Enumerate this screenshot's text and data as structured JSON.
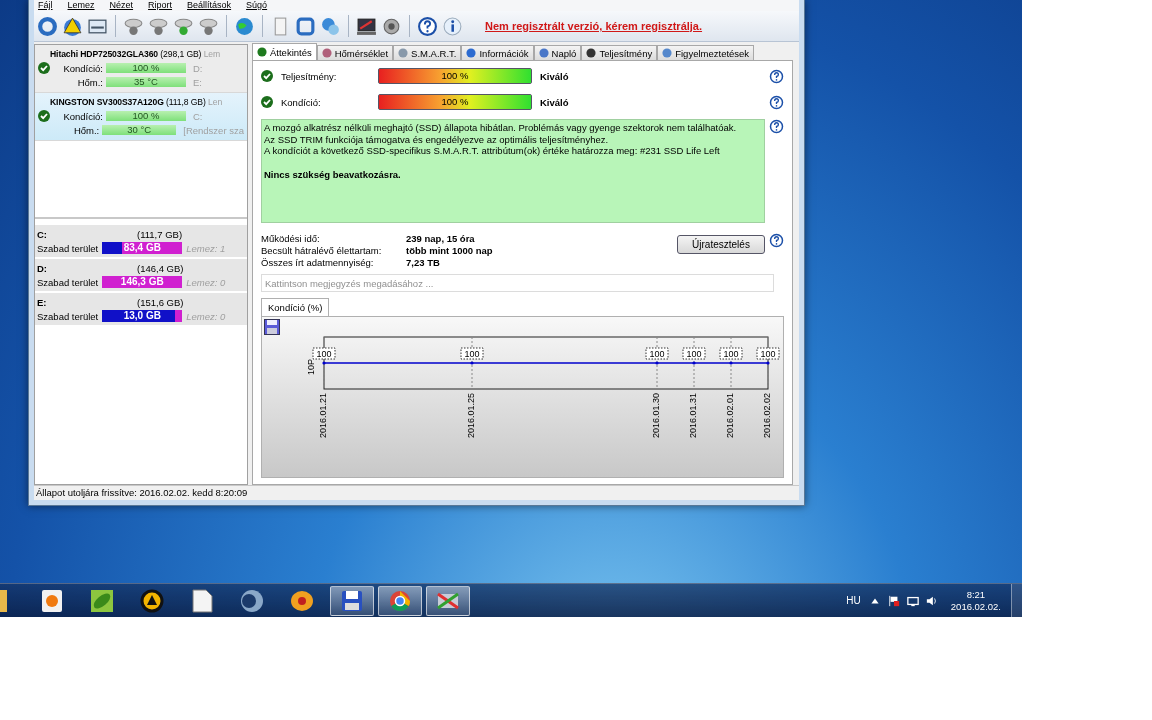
{
  "menu": [
    "Fájl",
    "Lemez",
    "Nézet",
    "Riport",
    "Beállítások",
    "Súgó"
  ],
  "register_link": "Nem regisztrált verzió, kérem regisztrálja.",
  "disks": [
    {
      "name": "Hitachi HDP725032GLA360",
      "size": "(298,1 GB)",
      "extra": "Lem",
      "selected": false,
      "rows": [
        {
          "label": "Kondíció:",
          "value": "100 %",
          "level": 1,
          "note": "D:"
        },
        {
          "label": "Hőm.:",
          "value": "35 °C",
          "level": 1,
          "note": "E:"
        }
      ]
    },
    {
      "name": "KINGSTON SV300S37A120G",
      "size": "(111,8 GB)",
      "extra": "Len",
      "selected": true,
      "rows": [
        {
          "label": "Kondíció:",
          "value": "100 %",
          "level": 1,
          "note": "C:"
        },
        {
          "label": "Hőm.:",
          "value": "30 °C",
          "level": 1,
          "note": "[Rendszer sza"
        }
      ]
    }
  ],
  "partitions": [
    {
      "letter": "C:",
      "size": "(111,7 GB)",
      "label": "Szabad terület",
      "free": "83,4 GB",
      "level": 0.75,
      "disk": "Lemez: 1"
    },
    {
      "letter": "D:",
      "size": "(146,4 GB)",
      "label": "Szabad terület",
      "free": "146,3 GB",
      "level": 1,
      "disk": "Lemez: 0"
    },
    {
      "letter": "E:",
      "size": "(151,6 GB)",
      "label": "Szabad terület",
      "free": "13,0 GB",
      "level": 0.09,
      "disk": "Lemez: 0"
    }
  ],
  "tabs": [
    {
      "label": "Áttekintés",
      "selected": true
    },
    {
      "label": "Hőmérséklet",
      "selected": false
    },
    {
      "label": "S.M.A.R.T.",
      "selected": false
    },
    {
      "label": "Információk",
      "selected": false
    },
    {
      "label": "Napló",
      "selected": false
    },
    {
      "label": "Teljesítmény",
      "selected": false
    },
    {
      "label": "Figyelmeztetések",
      "selected": false
    }
  ],
  "metrics": [
    {
      "label": "Teljesítmény:",
      "level": 1,
      "reading": "100 %",
      "rating": "Kiváló"
    },
    {
      "label": "Kondíció:",
      "level": 1,
      "reading": "100 %",
      "rating": "Kiváló"
    }
  ],
  "message": {
    "lines": [
      "A mozgó alkatrész nélküli meghajtó (SSD) állapota hibátlan. Problémás vagy gyenge szektorok nem találhatóak.",
      "Az SSD TRIM funkciója támogatva és engedélyezve az optimális teljesítményhez.",
      "A kondíciót a következő SSD-specifikus S.M.A.R.T. attribútum(ok) értéke határozza meg:  #231 SSD Life Left"
    ],
    "conclusion": "Nincs szükség beavatkozásra."
  },
  "stats": [
    {
      "label": "Működési idő:",
      "value": "239 nap, 15 óra"
    },
    {
      "label": "Becsült hátralévő élettartam:",
      "value": "több mint 1000 nap"
    },
    {
      "label": "Összes írt adatmennyiség:",
      "value": "7,23 TB"
    }
  ],
  "retest_button": "Újratesztelés",
  "note": {
    "placeholder": "Kattintson megjegyzés megadásához ..."
  },
  "chart_tab": "Kondíció  (%)",
  "chart": {
    "axis_text": "10P",
    "points": [
      {
        "date": "2016.01.21",
        "label": "100"
      },
      {
        "date": "2016.01.25",
        "label": "100"
      },
      {
        "date": "2016.01.30",
        "label": "100"
      },
      {
        "date": "2016.01.31",
        "label": "100"
      },
      {
        "date": "2016.02.01",
        "label": "100"
      },
      {
        "date": "2016.02.02",
        "label": "100"
      }
    ]
  },
  "status_bar": "Állapot utoljára frissítve: 2016.02.02. kedd 8:20:09",
  "taskbar": {
    "apps": [
      {
        "active": false
      },
      {
        "active": false
      },
      {
        "active": false
      },
      {
        "active": false
      },
      {
        "active": false
      },
      {
        "active": false
      },
      {
        "active": false
      },
      {
        "active": true
      },
      {
        "active": true
      },
      {
        "active": true
      }
    ],
    "language": "HU",
    "time": "8:21",
    "date": "2016.02.02."
  }
}
